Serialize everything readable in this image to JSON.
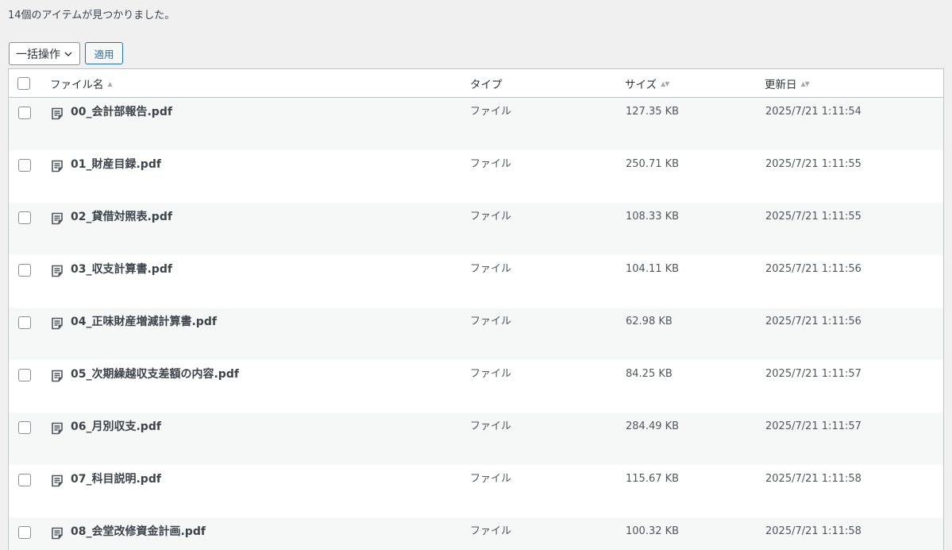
{
  "header": {
    "count_text": "14個のアイテムが見つかりました。"
  },
  "bulk": {
    "select_label": "一括操作",
    "apply_label": "適用"
  },
  "columns": {
    "name": "ファイル名",
    "type": "タイプ",
    "size": "サイズ",
    "modified": "更新日"
  },
  "rows": [
    {
      "name": "00_会計部報告.pdf",
      "type": "ファイル",
      "size": "127.35 KB",
      "modified": "2025/7/21 1:11:54"
    },
    {
      "name": "01_財産目録.pdf",
      "type": "ファイル",
      "size": "250.71 KB",
      "modified": "2025/7/21 1:11:55"
    },
    {
      "name": "02_貸借対照表.pdf",
      "type": "ファイル",
      "size": "108.33 KB",
      "modified": "2025/7/21 1:11:55"
    },
    {
      "name": "03_収支計算書.pdf",
      "type": "ファイル",
      "size": "104.11 KB",
      "modified": "2025/7/21 1:11:56"
    },
    {
      "name": "04_正味財産増減計算書.pdf",
      "type": "ファイル",
      "size": "62.98 KB",
      "modified": "2025/7/21 1:11:56"
    },
    {
      "name": "05_次期繰越収支差額の内容.pdf",
      "type": "ファイル",
      "size": "84.25 KB",
      "modified": "2025/7/21 1:11:57"
    },
    {
      "name": "06_月別収支.pdf",
      "type": "ファイル",
      "size": "284.49 KB",
      "modified": "2025/7/21 1:11:57"
    },
    {
      "name": "07_科目説明.pdf",
      "type": "ファイル",
      "size": "115.67 KB",
      "modified": "2025/7/21 1:11:58"
    },
    {
      "name": "08_会堂改修資金計画.pdf",
      "type": "ファイル",
      "size": "100.32 KB",
      "modified": "2025/7/21 1:11:58"
    }
  ],
  "icons": {
    "row_icon": "document-icon",
    "select_arrow": "chevron-down-icon",
    "sort": "sort-arrows-icon"
  },
  "colors": {
    "accent": "#2271b1",
    "background": "#f0f0f1",
    "row_alt": "#f6f7f7",
    "border": "#c3c4c7"
  }
}
